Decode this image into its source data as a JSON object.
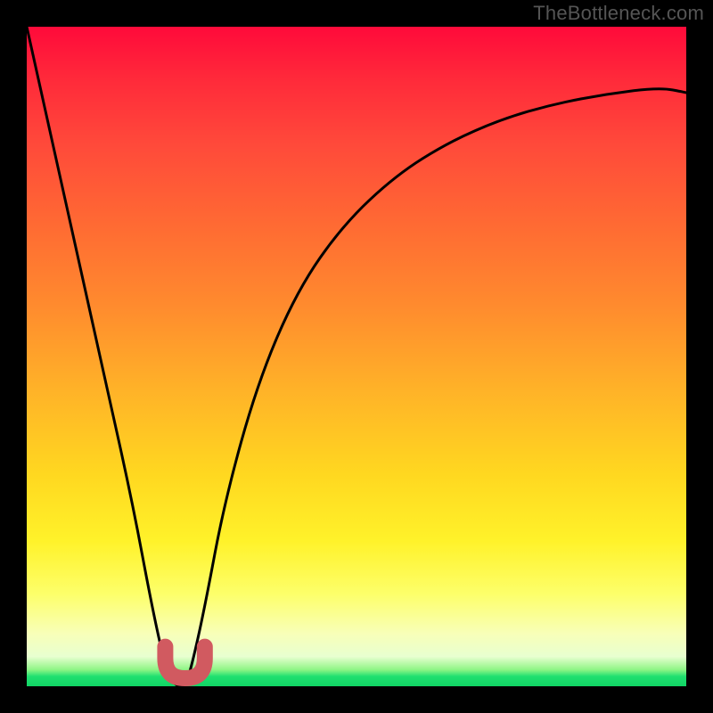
{
  "watermark": "TheBottleneck.com",
  "chart_data": {
    "type": "line",
    "title": "",
    "xlabel": "",
    "ylabel": "",
    "xlim": [
      0,
      100
    ],
    "ylim": [
      0,
      100
    ],
    "grid": false,
    "legend": false,
    "series": [
      {
        "name": "bottleneck-curve",
        "x": [
          0,
          4,
          8,
          12,
          16,
          19,
          21,
          22.5,
          24,
          25,
          27,
          30,
          35,
          41,
          48,
          56,
          64,
          72,
          80,
          88,
          96,
          100
        ],
        "values": [
          100,
          82,
          64,
          46,
          28,
          12,
          3,
          0,
          0,
          3,
          12,
          28,
          46,
          60,
          70,
          77.5,
          82.5,
          86,
          88.3,
          89.8,
          90.8,
          90
        ]
      }
    ],
    "valley_marker": {
      "name": "optimal-range",
      "shape": "U",
      "x_range": [
        21,
        27
      ],
      "y_range": [
        0,
        6
      ],
      "color": "#d15a60"
    },
    "background_gradient": {
      "top": "#ff0a3a",
      "mid1": "#ff8a2e",
      "mid2": "#fff22a",
      "band": "#f8ffb8",
      "bottom": "#10d565"
    }
  }
}
